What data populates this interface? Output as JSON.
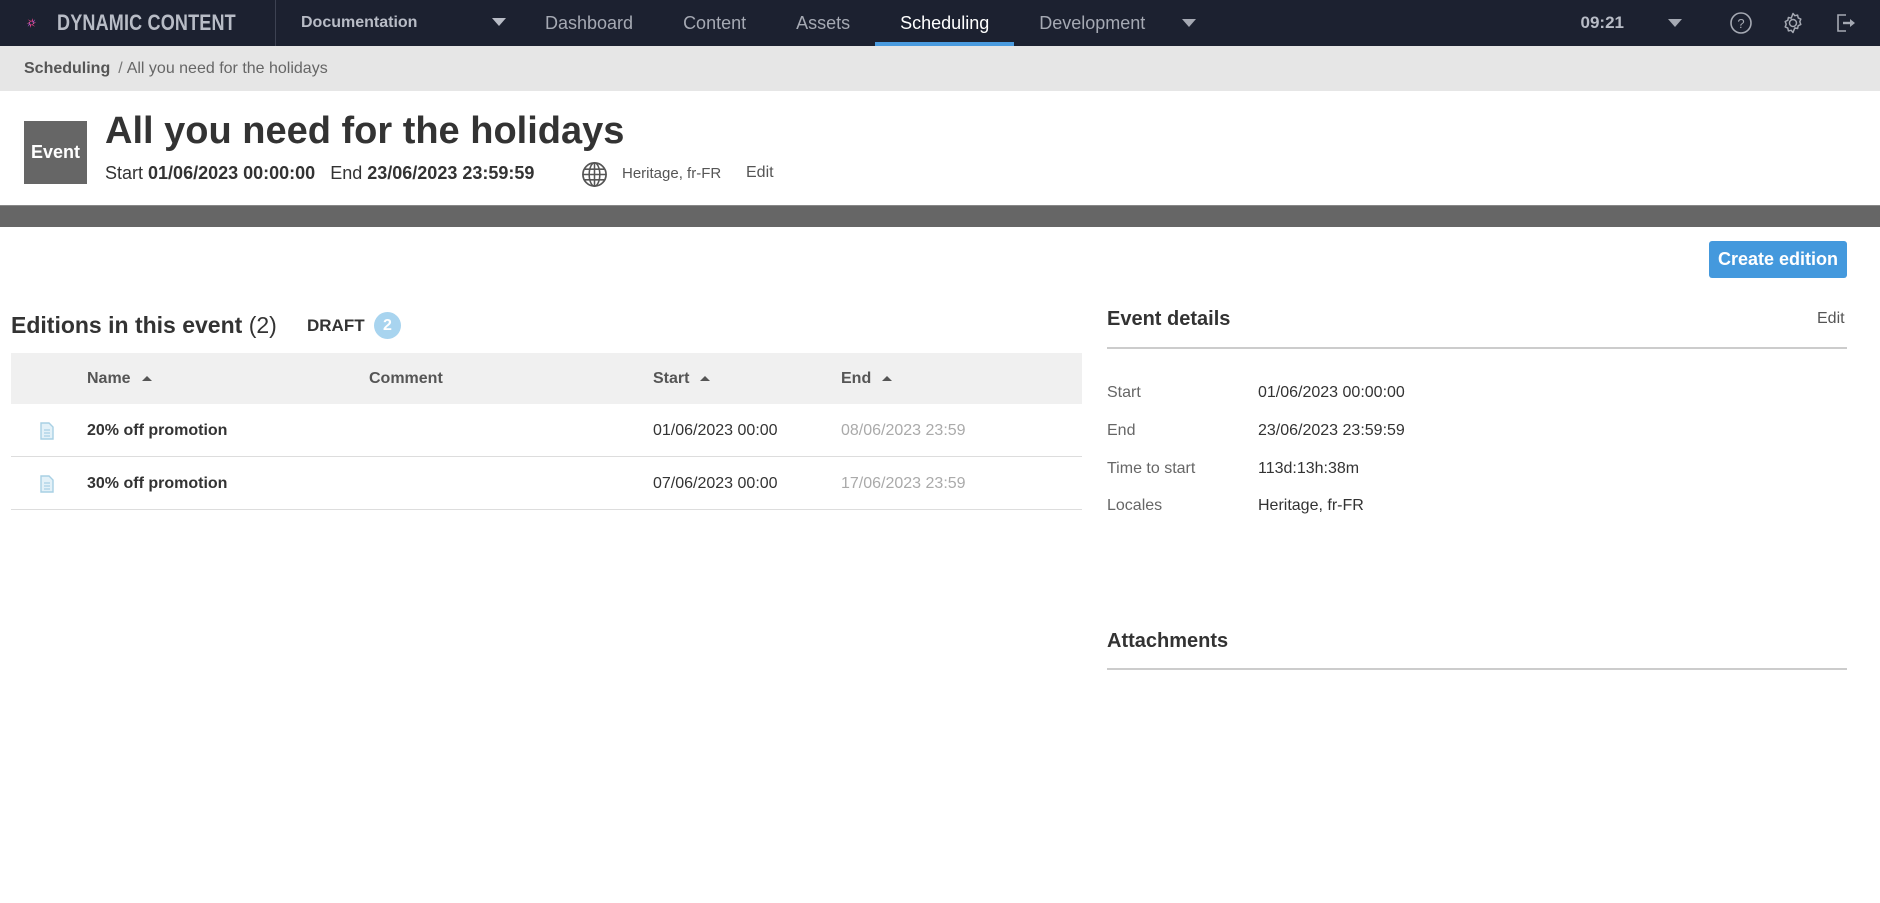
{
  "app": {
    "brand": "DYNAMIC CONTENT",
    "hub": "Documentation",
    "nav": [
      {
        "label": "Dashboard",
        "active": false
      },
      {
        "label": "Content",
        "active": false
      },
      {
        "label": "Assets",
        "active": false
      },
      {
        "label": "Scheduling",
        "active": true
      },
      {
        "label": "Development",
        "active": false
      }
    ],
    "time": "09:21",
    "icons": [
      "help-icon",
      "settings-gear-icon",
      "logout-icon"
    ],
    "accent_color": "#4a9bdf"
  },
  "breadcrumb": {
    "root": "Scheduling",
    "separator": "/",
    "current": "All you need for the holidays"
  },
  "event": {
    "badge": "Event",
    "title": "All you need for the holidays",
    "start_label": "Start",
    "start_value": "01/06/2023 00:00:00",
    "end_label": "End",
    "end_value": "23/06/2023 23:59:59",
    "locales": "Heritage, fr-FR",
    "edit_label": "Edit"
  },
  "actions": {
    "create_edition": "Create edition"
  },
  "editions": {
    "title": "Editions in this event",
    "count_text": "(2)",
    "draft_label": "DRAFT",
    "draft_count": "2",
    "columns": [
      "Name",
      "Comment",
      "Start",
      "End"
    ],
    "rows": [
      {
        "name": "20% off promotion",
        "comment": "",
        "start": "01/06/2023 00:00",
        "end": "08/06/2023 23:59"
      },
      {
        "name": "30% off promotion",
        "comment": "",
        "start": "07/06/2023 00:00",
        "end": "17/06/2023 23:59"
      }
    ]
  },
  "details": {
    "title": "Event details",
    "edit_label": "Edit",
    "fields": [
      {
        "label": "Start",
        "value": "01/06/2023 00:00:00"
      },
      {
        "label": "End",
        "value": "23/06/2023 23:59:59"
      },
      {
        "label": "Time to start",
        "value": "113d:13h:38m"
      },
      {
        "label": "Locales",
        "value": "Heritage, fr-FR"
      }
    ]
  },
  "attachments": {
    "title": "Attachments"
  }
}
